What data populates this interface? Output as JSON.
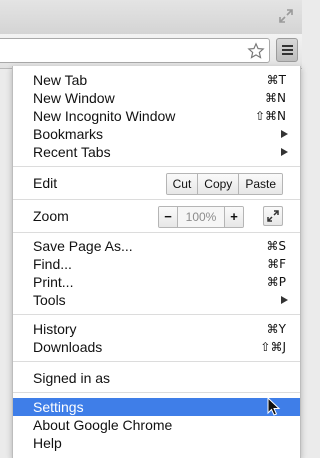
{
  "menu": {
    "group1": [
      {
        "label": "New Tab",
        "shortcut": "⌘T"
      },
      {
        "label": "New Window",
        "shortcut": "⌘N"
      },
      {
        "label": "New Incognito Window",
        "shortcut": "⇧⌘N"
      },
      {
        "label": "Bookmarks",
        "has_submenu": true
      },
      {
        "label": "Recent Tabs",
        "has_submenu": true
      }
    ],
    "edit": {
      "label": "Edit",
      "cut": "Cut",
      "copy": "Copy",
      "paste": "Paste"
    },
    "zoom": {
      "label": "Zoom",
      "minus": "−",
      "level": "100%",
      "plus": "+"
    },
    "group2": [
      {
        "label": "Save Page As...",
        "shortcut": "⌘S"
      },
      {
        "label": "Find...",
        "shortcut": "⌘F"
      },
      {
        "label": "Print...",
        "shortcut": "⌘P"
      },
      {
        "label": "Tools",
        "has_submenu": true
      }
    ],
    "group3": [
      {
        "label": "History",
        "shortcut": "⌘Y"
      },
      {
        "label": "Downloads",
        "shortcut": "⇧⌘J"
      }
    ],
    "signed_in": "Signed in as",
    "group4": [
      {
        "label": "Settings",
        "highlighted": true
      },
      {
        "label": "About Google Chrome"
      },
      {
        "label": "Help"
      }
    ]
  },
  "colors": {
    "highlight": "#3f7ee8",
    "menu_bg": "#ffffff",
    "toolbar_bg": "#e8e8e8"
  },
  "icons": {
    "fullscreen": "fullscreen-icon",
    "star": "star-icon",
    "menu": "hamburger-menu-icon",
    "cursor": "mouse-cursor-icon"
  }
}
